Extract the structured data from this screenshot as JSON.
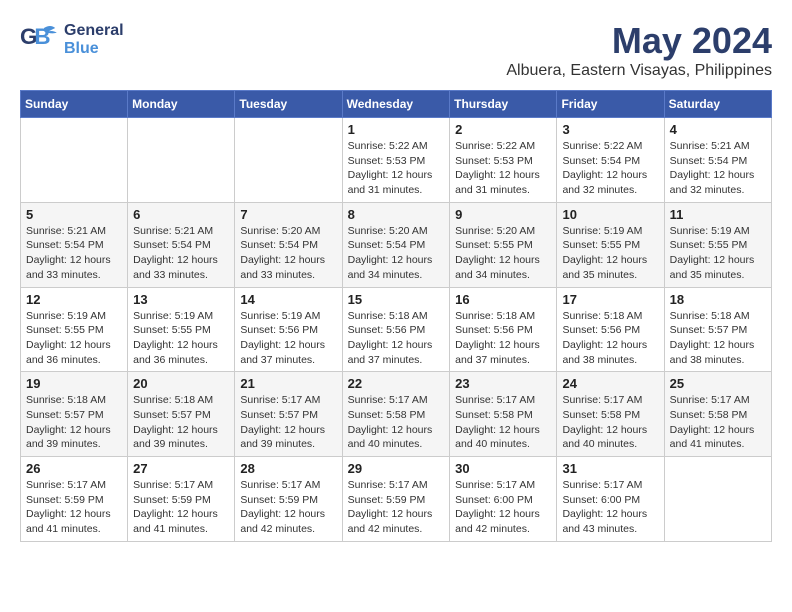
{
  "header": {
    "logo_general": "General",
    "logo_blue": "Blue",
    "month_title": "May 2024",
    "subtitle": "Albuera, Eastern Visayas, Philippines"
  },
  "weekdays": [
    "Sunday",
    "Monday",
    "Tuesday",
    "Wednesday",
    "Thursday",
    "Friday",
    "Saturday"
  ],
  "weeks": [
    [
      {
        "day": "",
        "info": ""
      },
      {
        "day": "",
        "info": ""
      },
      {
        "day": "",
        "info": ""
      },
      {
        "day": "1",
        "info": "Sunrise: 5:22 AM\nSunset: 5:53 PM\nDaylight: 12 hours\nand 31 minutes."
      },
      {
        "day": "2",
        "info": "Sunrise: 5:22 AM\nSunset: 5:53 PM\nDaylight: 12 hours\nand 31 minutes."
      },
      {
        "day": "3",
        "info": "Sunrise: 5:22 AM\nSunset: 5:54 PM\nDaylight: 12 hours\nand 32 minutes."
      },
      {
        "day": "4",
        "info": "Sunrise: 5:21 AM\nSunset: 5:54 PM\nDaylight: 12 hours\nand 32 minutes."
      }
    ],
    [
      {
        "day": "5",
        "info": "Sunrise: 5:21 AM\nSunset: 5:54 PM\nDaylight: 12 hours\nand 33 minutes."
      },
      {
        "day": "6",
        "info": "Sunrise: 5:21 AM\nSunset: 5:54 PM\nDaylight: 12 hours\nand 33 minutes."
      },
      {
        "day": "7",
        "info": "Sunrise: 5:20 AM\nSunset: 5:54 PM\nDaylight: 12 hours\nand 33 minutes."
      },
      {
        "day": "8",
        "info": "Sunrise: 5:20 AM\nSunset: 5:54 PM\nDaylight: 12 hours\nand 34 minutes."
      },
      {
        "day": "9",
        "info": "Sunrise: 5:20 AM\nSunset: 5:55 PM\nDaylight: 12 hours\nand 34 minutes."
      },
      {
        "day": "10",
        "info": "Sunrise: 5:19 AM\nSunset: 5:55 PM\nDaylight: 12 hours\nand 35 minutes."
      },
      {
        "day": "11",
        "info": "Sunrise: 5:19 AM\nSunset: 5:55 PM\nDaylight: 12 hours\nand 35 minutes."
      }
    ],
    [
      {
        "day": "12",
        "info": "Sunrise: 5:19 AM\nSunset: 5:55 PM\nDaylight: 12 hours\nand 36 minutes."
      },
      {
        "day": "13",
        "info": "Sunrise: 5:19 AM\nSunset: 5:55 PM\nDaylight: 12 hours\nand 36 minutes."
      },
      {
        "day": "14",
        "info": "Sunrise: 5:19 AM\nSunset: 5:56 PM\nDaylight: 12 hours\nand 37 minutes."
      },
      {
        "day": "15",
        "info": "Sunrise: 5:18 AM\nSunset: 5:56 PM\nDaylight: 12 hours\nand 37 minutes."
      },
      {
        "day": "16",
        "info": "Sunrise: 5:18 AM\nSunset: 5:56 PM\nDaylight: 12 hours\nand 37 minutes."
      },
      {
        "day": "17",
        "info": "Sunrise: 5:18 AM\nSunset: 5:56 PM\nDaylight: 12 hours\nand 38 minutes."
      },
      {
        "day": "18",
        "info": "Sunrise: 5:18 AM\nSunset: 5:57 PM\nDaylight: 12 hours\nand 38 minutes."
      }
    ],
    [
      {
        "day": "19",
        "info": "Sunrise: 5:18 AM\nSunset: 5:57 PM\nDaylight: 12 hours\nand 39 minutes."
      },
      {
        "day": "20",
        "info": "Sunrise: 5:18 AM\nSunset: 5:57 PM\nDaylight: 12 hours\nand 39 minutes."
      },
      {
        "day": "21",
        "info": "Sunrise: 5:17 AM\nSunset: 5:57 PM\nDaylight: 12 hours\nand 39 minutes."
      },
      {
        "day": "22",
        "info": "Sunrise: 5:17 AM\nSunset: 5:58 PM\nDaylight: 12 hours\nand 40 minutes."
      },
      {
        "day": "23",
        "info": "Sunrise: 5:17 AM\nSunset: 5:58 PM\nDaylight: 12 hours\nand 40 minutes."
      },
      {
        "day": "24",
        "info": "Sunrise: 5:17 AM\nSunset: 5:58 PM\nDaylight: 12 hours\nand 40 minutes."
      },
      {
        "day": "25",
        "info": "Sunrise: 5:17 AM\nSunset: 5:58 PM\nDaylight: 12 hours\nand 41 minutes."
      }
    ],
    [
      {
        "day": "26",
        "info": "Sunrise: 5:17 AM\nSunset: 5:59 PM\nDaylight: 12 hours\nand 41 minutes."
      },
      {
        "day": "27",
        "info": "Sunrise: 5:17 AM\nSunset: 5:59 PM\nDaylight: 12 hours\nand 41 minutes."
      },
      {
        "day": "28",
        "info": "Sunrise: 5:17 AM\nSunset: 5:59 PM\nDaylight: 12 hours\nand 42 minutes."
      },
      {
        "day": "29",
        "info": "Sunrise: 5:17 AM\nSunset: 5:59 PM\nDaylight: 12 hours\nand 42 minutes."
      },
      {
        "day": "30",
        "info": "Sunrise: 5:17 AM\nSunset: 6:00 PM\nDaylight: 12 hours\nand 42 minutes."
      },
      {
        "day": "31",
        "info": "Sunrise: 5:17 AM\nSunset: 6:00 PM\nDaylight: 12 hours\nand 43 minutes."
      },
      {
        "day": "",
        "info": ""
      }
    ]
  ]
}
